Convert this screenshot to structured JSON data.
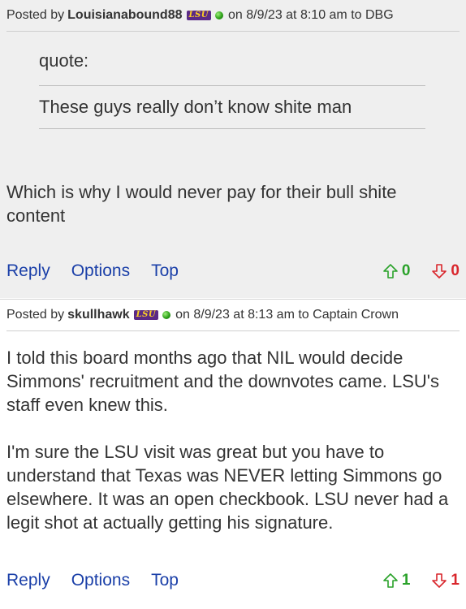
{
  "posts": [
    {
      "header": {
        "posted_by": "Posted by",
        "author": "Louisianabound88",
        "team_badge": "LSU",
        "meta": "on 8/9/23 at 8:10 am to DBG"
      },
      "quote": {
        "label": "quote:",
        "text": "These guys really don’t know shite man"
      },
      "body": "Which is why I would never pay for their bull shite content",
      "actions": {
        "reply": "Reply",
        "options": "Options",
        "top": "Top"
      },
      "votes": {
        "up": "0",
        "down": "0"
      }
    },
    {
      "header": {
        "posted_by": "Posted by",
        "author": "skullhawk",
        "team_badge": "LSU",
        "meta": "on 8/9/23 at 8:13 am to Captain Crown"
      },
      "body": "I told this board months ago that NIL would decide Simmons' recruitment and the downvotes came. LSU's staff even knew this.\n\nI'm sure the LSU visit was great but you have to understand that Texas was NEVER letting Simmons go elsewhere. It was an open checkbook. LSU never had a legit shot at actually getting his signature.",
      "actions": {
        "reply": "Reply",
        "options": "Options",
        "top": "Top"
      },
      "votes": {
        "up": "1",
        "down": "1"
      }
    }
  ],
  "colors": {
    "link": "#1a3fa8",
    "upvote": "#2aa22a",
    "downvote": "#d9262c",
    "post_bg_alt": "#efefef",
    "badge_bg": "#5b2a86",
    "badge_text": "#fdd023"
  },
  "icons": {
    "upvote": "arrow-up-outline-icon",
    "downvote": "arrow-down-outline-icon",
    "online": "online-status-dot-icon"
  }
}
